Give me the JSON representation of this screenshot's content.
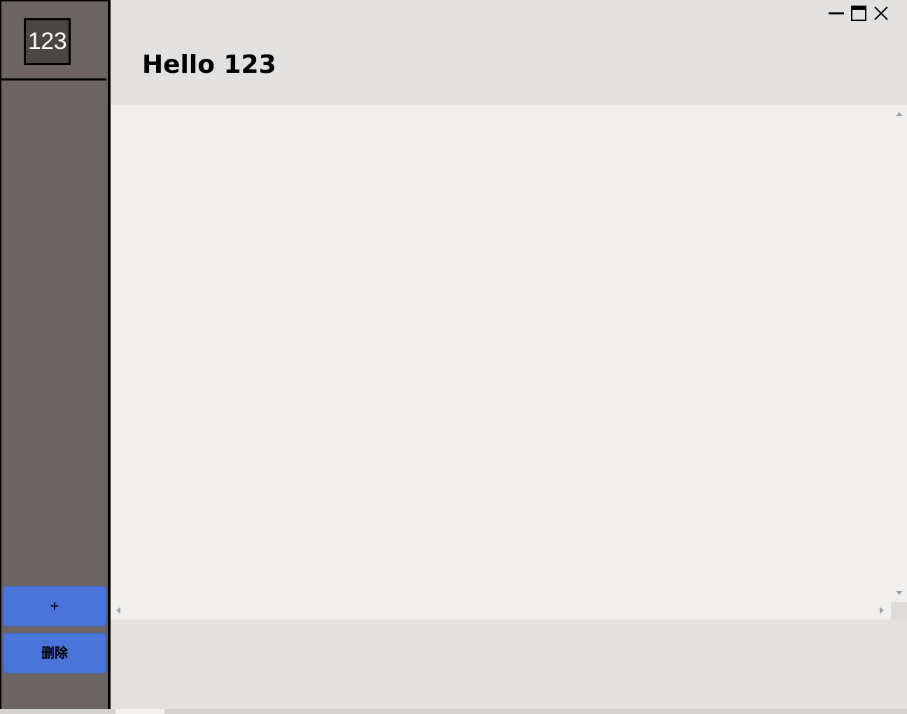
{
  "sidebar": {
    "avatar_text": "123",
    "add_button_label": "+",
    "delete_button_label": "删除"
  },
  "header": {
    "title": "Hello 123"
  },
  "window_controls": {
    "minimize_icon": "minimize-icon",
    "maximize_icon": "maximize-icon",
    "close_icon": "close-icon"
  },
  "colors": {
    "sidebar_bg": "#6b6462",
    "avatar_bg": "#4a4644",
    "button_accent": "#4a74d9",
    "content_bg": "#f0efed",
    "header_bg": "#e2e1df"
  }
}
